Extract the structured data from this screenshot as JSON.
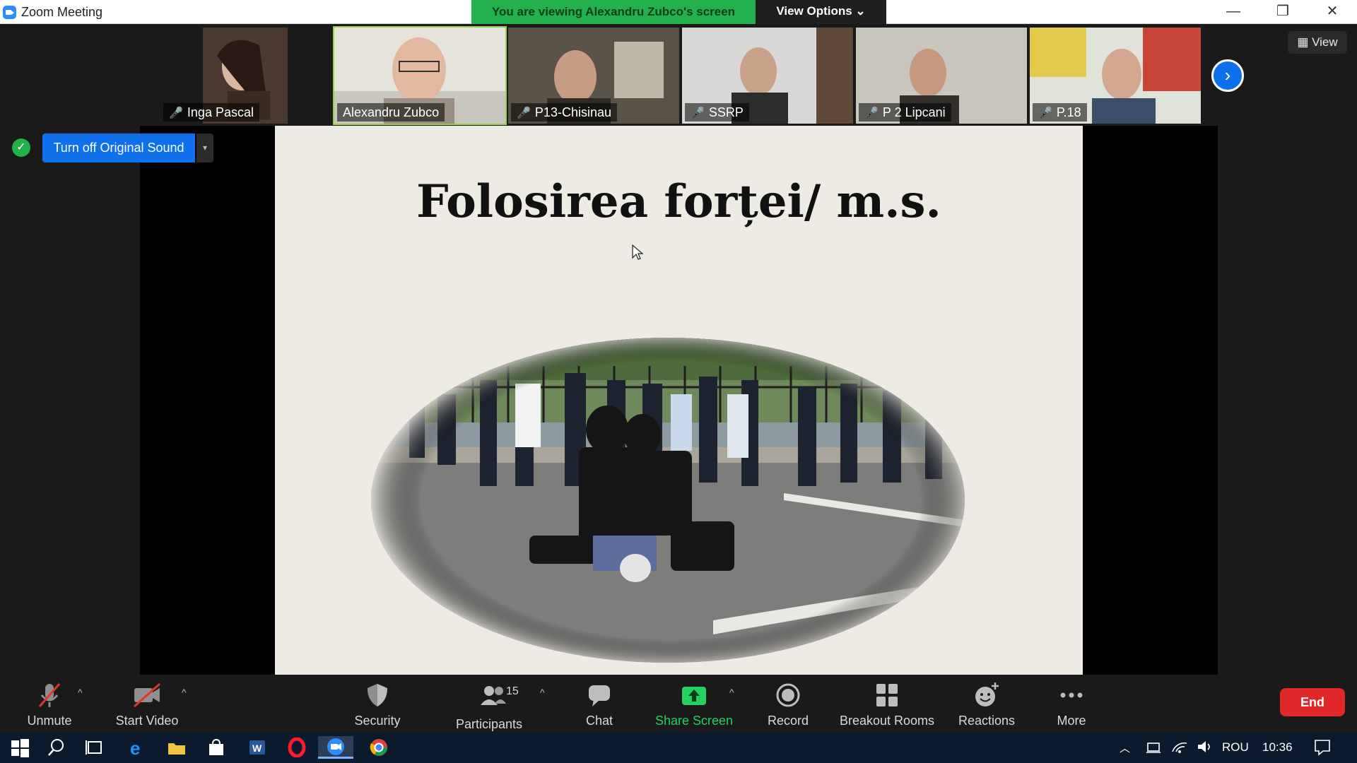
{
  "window": {
    "title": "Zoom Meeting",
    "viewing_banner": "You are viewing Alexandru Zubco's screen",
    "view_options": "View Options ⌄",
    "minimize": "—",
    "restore": "❐",
    "close": "✕"
  },
  "gallery": {
    "view_label": "View",
    "next_label": "›",
    "participants": [
      {
        "name": "Inga Pascal",
        "muted": true
      },
      {
        "name": "Alexandru Zubco",
        "muted": false,
        "active": true
      },
      {
        "name": "P13-Chisinau",
        "muted": true
      },
      {
        "name": "SSRP",
        "muted": true
      },
      {
        "name": "P 2 Lipcani",
        "muted": true
      },
      {
        "name": "P.18",
        "muted": true
      }
    ]
  },
  "audio": {
    "original_sound_button": "Turn off Original Sound",
    "dropdown": "▾"
  },
  "slide": {
    "title": "Folosirea forței/ m.s."
  },
  "toolbar": {
    "unmute": "Unmute",
    "start_video": "Start Video",
    "security": "Security",
    "participants": "Participants",
    "participants_count": "15",
    "chat": "Chat",
    "share_screen": "Share Screen",
    "record": "Record",
    "breakout_rooms": "Breakout Rooms",
    "reactions": "Reactions",
    "more": "More",
    "end": "End",
    "caret": "^"
  },
  "taskbar": {
    "language": "ROU",
    "time": "10:36"
  },
  "colors": {
    "zoom_blue": "#0e71eb",
    "banner_green": "#23b14d",
    "end_red": "#e02828",
    "mute_red": "#e5332a"
  }
}
